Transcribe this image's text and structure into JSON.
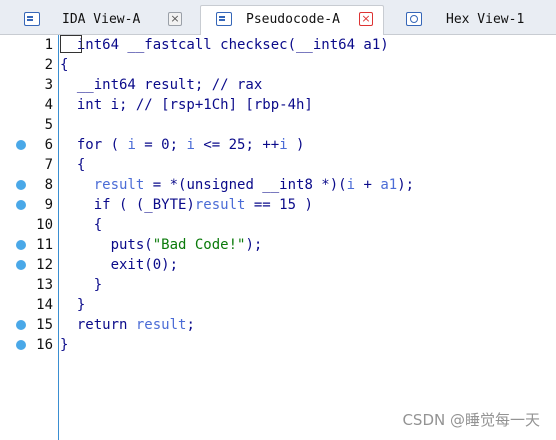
{
  "tabs": [
    {
      "label": "IDA View-A",
      "icon": "ida-view-icon",
      "active": false
    },
    {
      "label": "Pseudocode-A",
      "icon": "pseudocode-icon",
      "active": true
    },
    {
      "label": "Hex View-1",
      "icon": "hex-view-icon",
      "active": false
    }
  ],
  "close_glyph": "×",
  "lines": [
    {
      "n": "1",
      "bp": false,
      "segs": [
        {
          "t": "__int64 __fastcall checksec(__int64 a1)",
          "c": "dark"
        }
      ]
    },
    {
      "n": "2",
      "bp": false,
      "segs": [
        {
          "t": "{",
          "c": "dark"
        }
      ]
    },
    {
      "n": "3",
      "bp": false,
      "segs": [
        {
          "t": "  __int64 result; // rax",
          "c": "dark"
        }
      ]
    },
    {
      "n": "4",
      "bp": false,
      "segs": [
        {
          "t": "  int i; // [rsp+1Ch] [rbp-4h]",
          "c": "dark"
        }
      ]
    },
    {
      "n": "5",
      "bp": false,
      "segs": [
        {
          "t": "",
          "c": "dark"
        }
      ]
    },
    {
      "n": "6",
      "bp": true,
      "segs": [
        {
          "t": "  for ( ",
          "c": "dark"
        },
        {
          "t": "i",
          "c": "var"
        },
        {
          "t": " = 0; ",
          "c": "dark"
        },
        {
          "t": "i",
          "c": "var"
        },
        {
          "t": " <= 25; ++",
          "c": "dark"
        },
        {
          "t": "i",
          "c": "var"
        },
        {
          "t": " )",
          "c": "dark"
        }
      ]
    },
    {
      "n": "7",
      "bp": false,
      "segs": [
        {
          "t": "  {",
          "c": "dark"
        }
      ]
    },
    {
      "n": "8",
      "bp": true,
      "segs": [
        {
          "t": "    ",
          "c": "dark"
        },
        {
          "t": "result",
          "c": "var"
        },
        {
          "t": " = *(unsigned __int8 *)(",
          "c": "dark"
        },
        {
          "t": "i",
          "c": "var"
        },
        {
          "t": " + ",
          "c": "dark"
        },
        {
          "t": "a1",
          "c": "var"
        },
        {
          "t": ");",
          "c": "dark"
        }
      ]
    },
    {
      "n": "9",
      "bp": true,
      "segs": [
        {
          "t": "    if ( (_BYTE)",
          "c": "dark"
        },
        {
          "t": "result",
          "c": "var"
        },
        {
          "t": " == 15 )",
          "c": "dark"
        }
      ]
    },
    {
      "n": "10",
      "bp": false,
      "segs": [
        {
          "t": "    {",
          "c": "dark"
        }
      ]
    },
    {
      "n": "11",
      "bp": true,
      "segs": [
        {
          "t": "      puts(",
          "c": "dark"
        },
        {
          "t": "\"Bad Code!\"",
          "c": "green"
        },
        {
          "t": ");",
          "c": "dark"
        }
      ]
    },
    {
      "n": "12",
      "bp": true,
      "segs": [
        {
          "t": "      exit(0);",
          "c": "dark"
        }
      ]
    },
    {
      "n": "13",
      "bp": false,
      "segs": [
        {
          "t": "    }",
          "c": "dark"
        }
      ]
    },
    {
      "n": "14",
      "bp": false,
      "segs": [
        {
          "t": "  }",
          "c": "dark"
        }
      ]
    },
    {
      "n": "15",
      "bp": true,
      "segs": [
        {
          "t": "  return ",
          "c": "dark"
        },
        {
          "t": "result",
          "c": "var"
        },
        {
          "t": ";",
          "c": "dark"
        }
      ]
    },
    {
      "n": "16",
      "bp": true,
      "segs": [
        {
          "t": "}",
          "c": "dark"
        }
      ]
    }
  ],
  "watermark": "CSDN @睡觉每一天",
  "colors": {
    "breakpoint": "#4aa8e8",
    "gutter_line": "#3a8ed1",
    "variable": "#4b6cd6",
    "string": "#0a7a0a"
  }
}
